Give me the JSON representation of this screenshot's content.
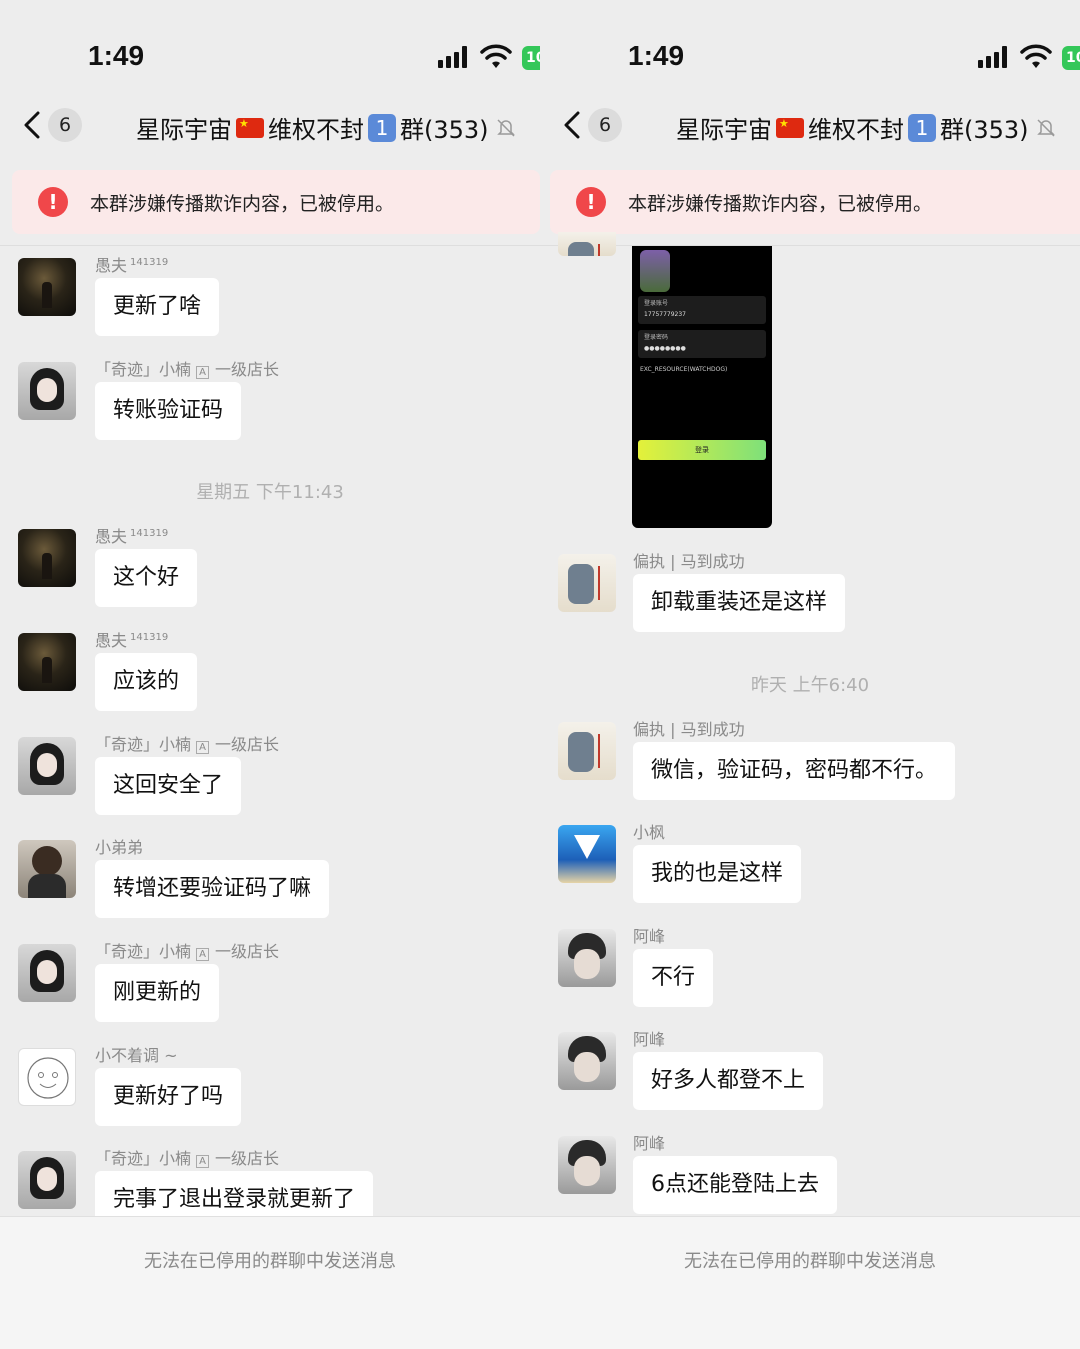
{
  "status_bar": {
    "time": "1:49",
    "battery_label": "10"
  },
  "nav": {
    "back_count": "6",
    "title_part1": "星际宇宙",
    "title_part2": "维权不封",
    "title_keycap": "1",
    "title_part3": "群(353)"
  },
  "banner": {
    "icon": "!",
    "text": "本群涉嫌传播欺诈内容，已被停用。"
  },
  "footer": {
    "text": "无法在已停用的群聊中发送消息"
  },
  "left_messages": [
    {
      "sender": "愚夫",
      "badge": "141319",
      "role": "",
      "text": "更新了啥"
    },
    {
      "sender": "「奇迹」小楠",
      "badge": "",
      "role": "一级店长",
      "text": "转账验证码"
    },
    {
      "sender": "愚夫",
      "badge": "141319",
      "role": "",
      "text": "这个好"
    },
    {
      "sender": "愚夫",
      "badge": "141319",
      "role": "",
      "text": "应该的"
    },
    {
      "sender": "「奇迹」小楠",
      "badge": "",
      "role": "一级店长",
      "text": "这回安全了"
    },
    {
      "sender": "小弟弟",
      "badge": "",
      "role": "",
      "text": "转增还要验证码了嘛"
    },
    {
      "sender": "「奇迹」小楠",
      "badge": "",
      "role": "一级店长",
      "text": "刚更新的"
    },
    {
      "sender": "小不着调 ~",
      "badge": "",
      "role": "",
      "text": "更新好了吗"
    },
    {
      "sender": "「奇迹」小楠",
      "badge": "",
      "role": "一级店长",
      "text": "完事了退出登录就更新了"
    }
  ],
  "left_timestamp": "星期五 下午11:43",
  "role_tag_glyph": "A",
  "right_timestamp": "昨天 上午6:40",
  "screenshot": {
    "field1_label": "登录账号",
    "field1_value": "17757779237",
    "field2_label": "登录密码",
    "field2_value": "●●●●●●●●",
    "check_text": "EXC_RESOURCE(WATCHDOG)",
    "login_button": "登录"
  },
  "right_messages": [
    {
      "sender": "偏执 | 马到成功",
      "text": "卸载重装还是这样"
    },
    {
      "sender": "偏执 | 马到成功",
      "text": "微信，验证码，密码都不行。"
    },
    {
      "sender": "小枫",
      "text": "我的也是这样"
    },
    {
      "sender": "阿峰",
      "text": "不行"
    },
    {
      "sender": "阿峰",
      "text": "好多人都登不上"
    },
    {
      "sender": "阿峰",
      "text": "6点还能登陆上去"
    }
  ]
}
